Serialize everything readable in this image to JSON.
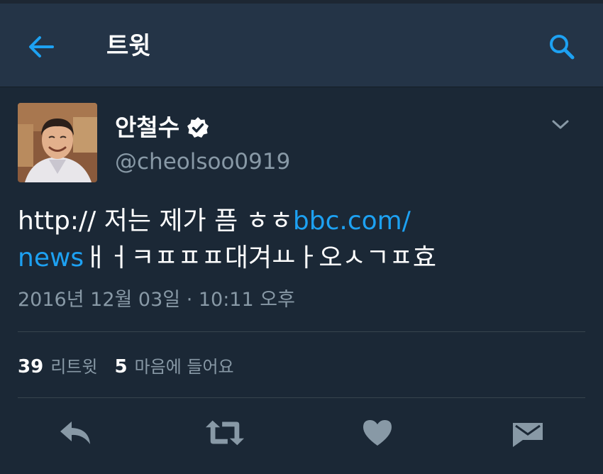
{
  "header": {
    "title": "트윗",
    "back_icon": "arrow-left-icon",
    "search_icon": "search-icon"
  },
  "tweet": {
    "author": {
      "display_name": "안철수",
      "handle": "@cheolsoo0919",
      "verified_icon": "verified-badge-icon",
      "avatar": "profile-photo"
    },
    "text_line1_plain": "http:// 저는 제가 픔 ㅎㅎ",
    "text_line1_link": "bbc.com/",
    "text_line2_link": "news",
    "text_line2_plain": "ㅐㅓㅋㅍㅍㅍ대겨ㅛㅏ오ㅅㄱㅍ효",
    "timestamp": "2016년 12월 03일 · 10:11 오후",
    "retweet_count": "39",
    "retweet_label": "리트윗",
    "like_count": "5",
    "like_label": "마음에 들어요"
  },
  "actions": [
    "reply-icon",
    "retweet-icon",
    "heart-icon",
    "message-icon"
  ],
  "colors": {
    "background": "#1b2836",
    "header": "#243447",
    "accent": "#1da1f2",
    "secondary_text": "#8899a6",
    "icon": "#8899a6"
  }
}
